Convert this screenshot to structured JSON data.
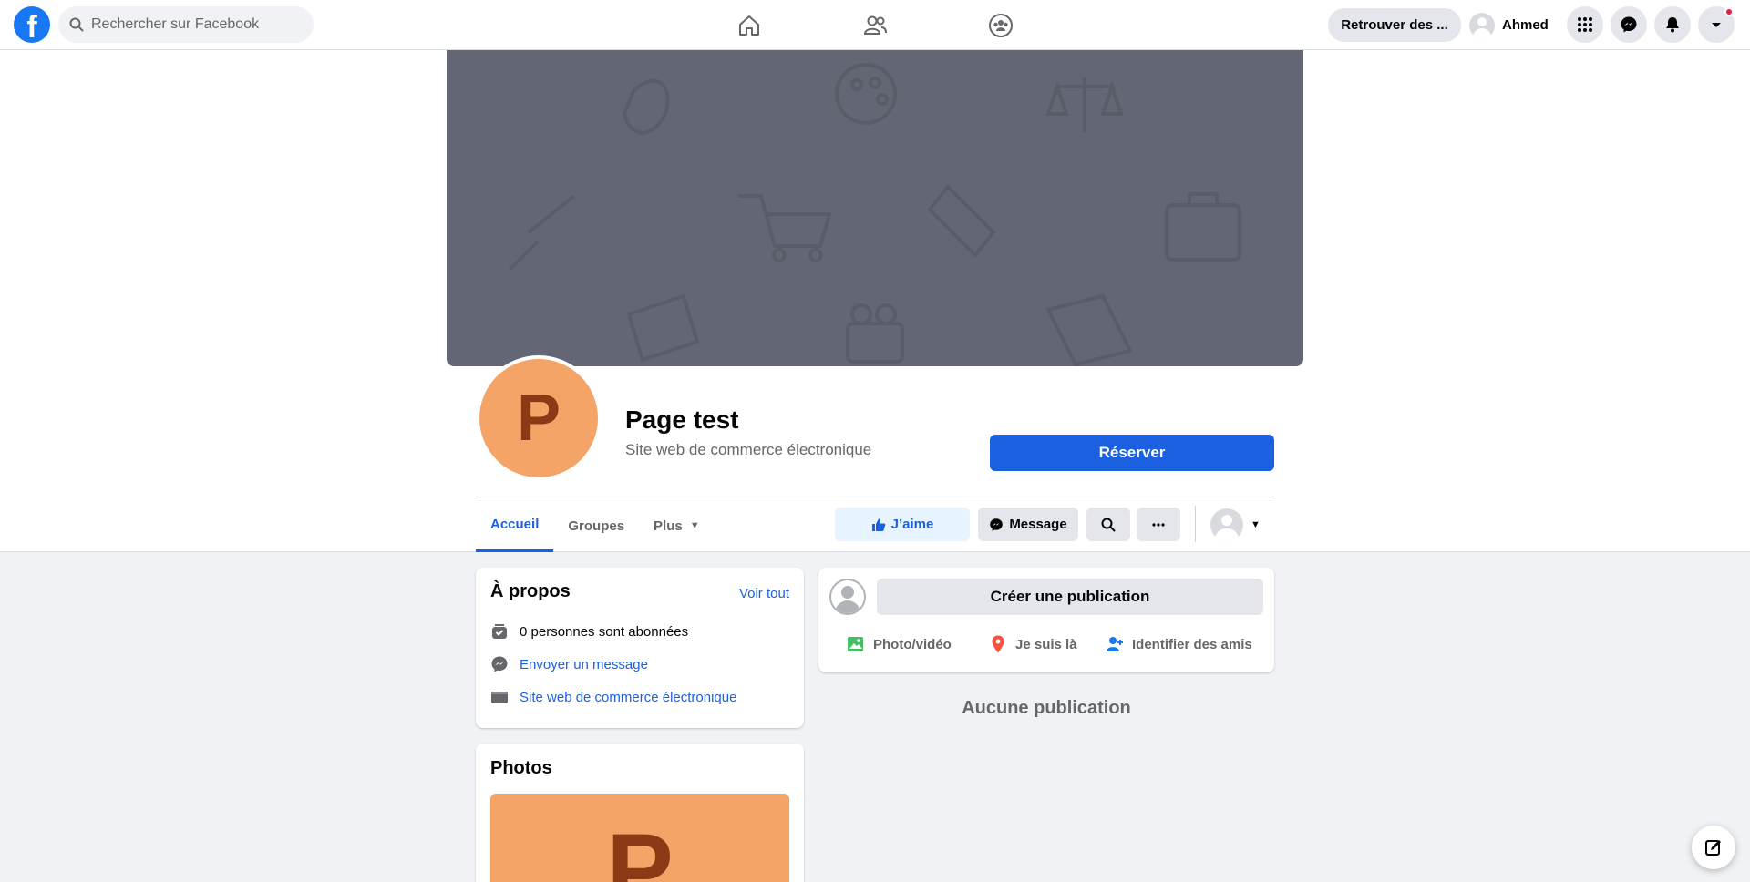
{
  "topbar": {
    "logo": "f",
    "search_placeholder": "Rechercher sur Facebook",
    "retrouver_label": "Retrouver des ...",
    "user_name": "Ahmed"
  },
  "page": {
    "avatar_letter": "P",
    "title": "Page test",
    "category": "Site web de commerce électronique",
    "reserve_label": "Réserver"
  },
  "tabs": {
    "home": "Accueil",
    "groups": "Groupes",
    "more": "Plus"
  },
  "actions": {
    "like": "J’aime",
    "message": "Message"
  },
  "about": {
    "title": "À propos",
    "see_all": "Voir tout",
    "followers": "0 personnes sont abonnées",
    "send_message": "Envoyer un message",
    "category_link": "Site web de commerce électronique"
  },
  "photos": {
    "title": "Photos",
    "thumb_letter": "P"
  },
  "composer": {
    "create_post": "Créer une publication",
    "photo_video": "Photo/vidéo",
    "checkin": "Je suis là",
    "tag_friends": "Identifier des amis"
  },
  "feed": {
    "empty": "Aucune publication"
  },
  "colors": {
    "brand_blue": "#1877f2",
    "primary_button": "#1b61df",
    "cover": "#636775",
    "avatar_orange": "#f4a466",
    "avatar_letter": "#8c3a16"
  }
}
